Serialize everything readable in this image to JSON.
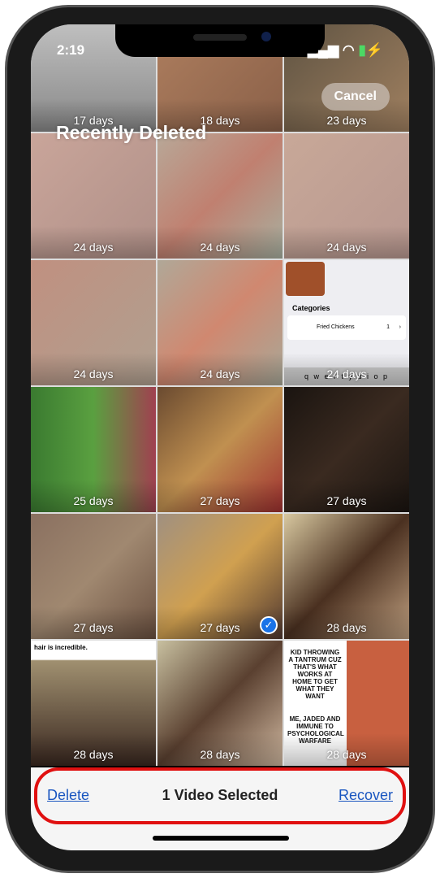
{
  "status": {
    "time": "2:19"
  },
  "header": {
    "title": "Recently Deleted",
    "cancel": "Cancel"
  },
  "tiles": [
    {
      "days": "17 days",
      "bg": "linear-gradient(#c8c8c8,#888)"
    },
    {
      "days": "18 days",
      "bg": "linear-gradient(135deg,#b08060,#8a6048)"
    },
    {
      "days": "23 days",
      "bg": "linear-gradient(135deg,#5a5040,#a08060)"
    },
    {
      "days": "24 days",
      "bg": "linear-gradient(135deg,#c9a59a,#b09088)"
    },
    {
      "days": "24 days",
      "bg": "linear-gradient(135deg,#b8a898,#c08070,#a8b0a0)"
    },
    {
      "days": "24 days",
      "bg": "linear-gradient(135deg,#c8a898,#b89890)"
    },
    {
      "days": "24 days",
      "bg": "linear-gradient(135deg,#c09080,#b0a090)"
    },
    {
      "days": "24 days",
      "bg": "linear-gradient(135deg,#b0a898,#d08870,#a8a898)"
    },
    {
      "days": "24 days",
      "bg": "#eeeef2"
    },
    {
      "days": "25 days",
      "bg": "linear-gradient(90deg,#3a7a30,#5aa040,#a04050)"
    },
    {
      "days": "27 days",
      "bg": "linear-gradient(135deg,#6a4a30,#c09050,#a03030)"
    },
    {
      "days": "27 days",
      "bg": "linear-gradient(135deg,#1a1410,#3a2a20,#1a1410)"
    },
    {
      "days": "27 days",
      "bg": "linear-gradient(135deg,#8a7060,#a08870,#6a5040)"
    },
    {
      "days": "27 days",
      "bg": "linear-gradient(135deg,#a09080,#d0a050,#503830)",
      "selected": true
    },
    {
      "days": "28 days",
      "bg": "linear-gradient(135deg,#d8c8a0,#4a3020,#c0a080)"
    },
    {
      "days": "28 days",
      "bg": "linear-gradient(#fff 15%,#a09070 16%,#3a2820)"
    },
    {
      "days": "28 days",
      "bg": "linear-gradient(135deg,#c8c0a0,#5a4030,#d0b8a0)"
    },
    {
      "days": "28 days",
      "bg": "linear-gradient(90deg,#fff 50%,#c86040 50%)"
    }
  ],
  "recipe": {
    "heading": "Categories",
    "item": "Fried Chickens",
    "count": "1",
    "keys": "q w e r t y u i o p"
  },
  "memes": {
    "top": "KID THROWING A TANTRUM CUZ THAT'S WHAT WORKS AT HOME TO GET WHAT THEY WANT",
    "bottom": "ME, JADED AND IMMUNE TO PSYCHOLOGICAL WARFARE",
    "caption": "hair is incredible."
  },
  "toolbar": {
    "delete": "Delete",
    "selected": "1 Video Selected",
    "recover": "Recover"
  },
  "colors": {
    "accent": "#1a56c0",
    "highlight": "#e01010"
  }
}
